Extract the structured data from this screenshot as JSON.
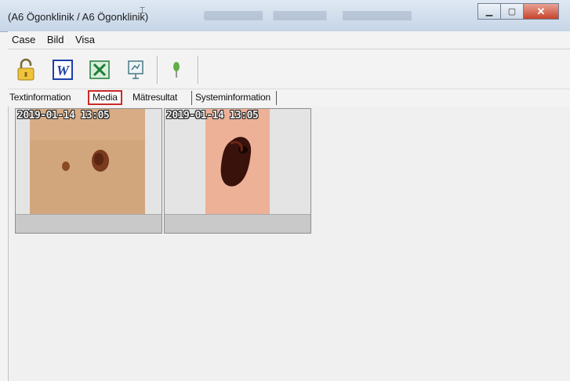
{
  "window": {
    "title": "(A6 Ögonklinik / A6 Ögonklinik)"
  },
  "menu": {
    "items": [
      "Case",
      "Bild",
      "Visa"
    ]
  },
  "toolbar": {
    "buttons": [
      {
        "icon": "lock-icon",
        "color": "#e8b730"
      },
      {
        "icon": "word-icon",
        "color": "#1d3fa8"
      },
      {
        "icon": "excel-icon",
        "color": "#1e7d3a"
      },
      {
        "icon": "presentation-icon",
        "color": "#4a7a86"
      },
      {
        "icon": "pin-icon",
        "color": "#4f9d3c"
      }
    ]
  },
  "tabs": [
    {
      "label": "Textinformation",
      "active": false
    },
    {
      "label": "Media",
      "active": true
    },
    {
      "label": "Mätresultat",
      "active": false
    },
    {
      "label": "Systeminformation",
      "active": false
    }
  ],
  "media": {
    "items": [
      {
        "timestamp": "2019-01-14 13:05",
        "subject": "small-pigmented-lesion-photo"
      },
      {
        "timestamp": "2019-01-14 13:05",
        "subject": "dark-mole-closeup-photo"
      }
    ]
  },
  "colors": {
    "active_tab_highlight": "#c92a2a",
    "close_button": "#c7442c"
  }
}
